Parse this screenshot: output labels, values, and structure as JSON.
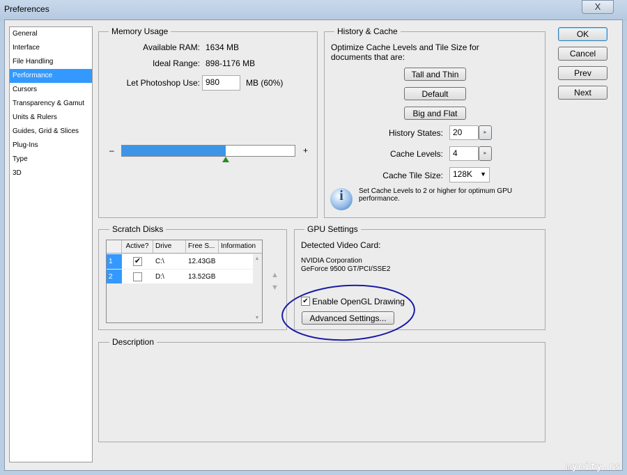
{
  "window": {
    "title": "Preferences",
    "close": "X"
  },
  "nav": [
    "General",
    "Interface",
    "File Handling",
    "Performance",
    "Cursors",
    "Transparency & Gamut",
    "Units & Rulers",
    "Guides, Grid & Slices",
    "Plug-Ins",
    "Type",
    "3D"
  ],
  "buttons": {
    "ok": "OK",
    "cancel": "Cancel",
    "prev": "Prev",
    "next": "Next"
  },
  "memory": {
    "title": "Memory Usage",
    "available_label": "Available RAM:",
    "available": "1634 MB",
    "ideal_label": "Ideal Range:",
    "ideal": "898-1176 MB",
    "use_label": "Let Photoshop Use:",
    "use_value": "980",
    "use_suffix": "MB (60%)",
    "minus": "–",
    "plus": "+",
    "fill_percent": 60
  },
  "history": {
    "title": "History & Cache",
    "desc": "Optimize Cache Levels and Tile Size for documents that are:",
    "tall": "Tall and Thin",
    "default": "Default",
    "big": "Big and Flat",
    "states_label": "History States:",
    "states": "20",
    "levels_label": "Cache Levels:",
    "levels": "4",
    "tile_label": "Cache Tile Size:",
    "tile": "128K",
    "info": "Set Cache Levels to 2 or higher for optimum GPU performance."
  },
  "scratch": {
    "title": "Scratch Disks",
    "headers": [
      "Active?",
      "Drive",
      "Free S...",
      "Information"
    ],
    "rows": [
      {
        "n": "1",
        "active": true,
        "drive": "C:\\",
        "free": "12.43GB"
      },
      {
        "n": "2",
        "active": false,
        "drive": "D:\\",
        "free": "13.52GB"
      }
    ]
  },
  "gpu": {
    "title": "GPU Settings",
    "detected": "Detected Video Card:",
    "vendor": "NVIDIA Corporation",
    "card": "GeForce 9500 GT/PCI/SSE2",
    "opengl": "Enable OpenGL Drawing",
    "advanced": "Advanced Settings..."
  },
  "description": {
    "title": "Description"
  },
  "watermark": "mycity.rs",
  "colors": {
    "accent": "#3399ff",
    "annotation": "#1a1aa8"
  }
}
